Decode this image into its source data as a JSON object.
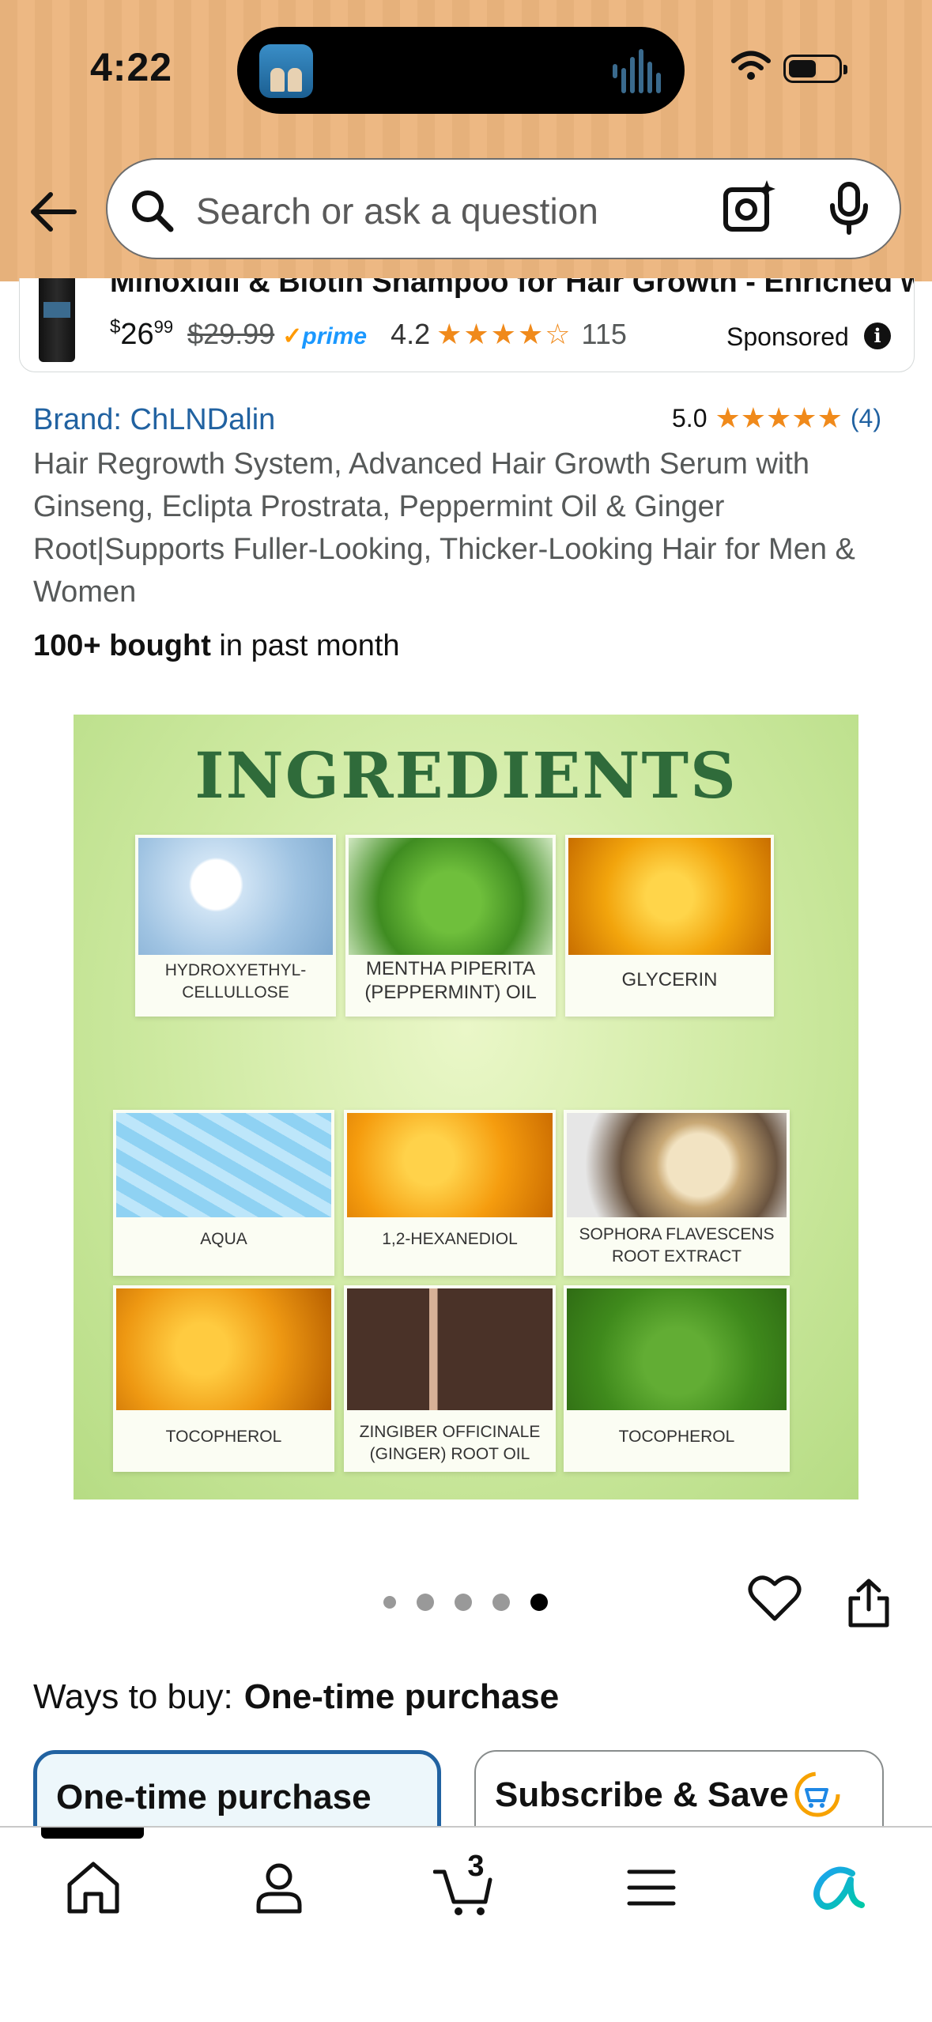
{
  "status_bar": {
    "time": "4:22"
  },
  "search": {
    "placeholder": "Search or ask a question"
  },
  "sponsored_ad": {
    "title": "Minoxidil & Biotin Shampoo for Hair Growth - Enriched with...",
    "price_currency": "$",
    "price_dollars": "26",
    "price_cents": "99",
    "list_price": "$29.99",
    "prime_label": "prime",
    "rating": "4.2",
    "stars_glyphs": "★★★★☆",
    "review_count": "115",
    "label": "Sponsored"
  },
  "product": {
    "brand": "Brand: ChLNDalin",
    "rating": "5.0",
    "stars_glyphs": "★★★★★",
    "review_count": "(4)",
    "title": "Hair Regrowth System, Advanced Hair Growth Serum with Ginseng, Eclipta Prostrata, Peppermint Oil & Ginger Root|Supports Fuller-Looking, Thicker-Looking Hair for Men & Women",
    "bought_bold": "100+ bought",
    "bought_rest": " in past month"
  },
  "image": {
    "heading": "INGREDIENTS",
    "ingredients": [
      {
        "line1": "HYDROXYETHYL-",
        "line2": "CELLULLOSE"
      },
      {
        "line1": "MENTHA PIPERITA",
        "line2": "(PEPPERMINT) OIL"
      },
      {
        "line1": "GLYCERIN",
        "line2": ""
      },
      {
        "line1": "AQUA",
        "line2": ""
      },
      {
        "line1": "1,2-HEXANEDIOL",
        "line2": ""
      },
      {
        "line1": "SOPHORA FLAVESCENS",
        "line2": "ROOT EXTRACT"
      },
      {
        "line1": "TOCOPHEROL",
        "line2": ""
      },
      {
        "line1": "ZINGIBER OFFICINALE",
        "line2": "(GINGER) ROOT OIL"
      },
      {
        "line1": "TOCOPHEROL",
        "line2": ""
      }
    ],
    "carousel_total": 5,
    "carousel_active": 5
  },
  "buy": {
    "ways_label": "Ways to buy:",
    "ways_value": "One-time purchase",
    "option_one_time": "One-time purchase",
    "option_subscribe": "Subscribe & Save"
  },
  "nav": {
    "cart_count": "3"
  },
  "colors": {
    "header_bg": "#ecb57e",
    "link_blue": "#2162a1",
    "star_orange": "#f08a1b",
    "prime_blue": "#1a98ff",
    "ingredients_green": "#2f6b3a"
  },
  "icons": [
    "back-arrow-icon",
    "search-icon",
    "camera-lens-icon",
    "microphone-icon",
    "info-icon",
    "heart-icon",
    "share-icon",
    "home-icon",
    "account-icon",
    "cart-icon",
    "menu-icon",
    "rufus-icon",
    "subscribe-save-icon"
  ]
}
